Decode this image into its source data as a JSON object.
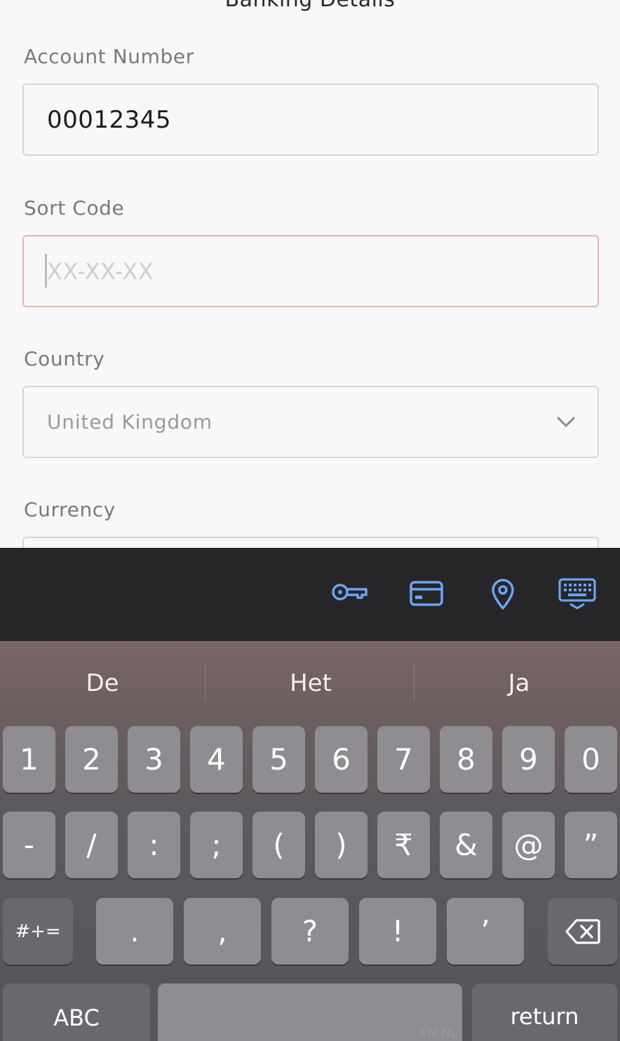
{
  "page": {
    "title": "Banking Details"
  },
  "fields": {
    "account_number": {
      "label": "Account Number",
      "value": "00012345"
    },
    "sort_code": {
      "label": "Sort Code",
      "placeholder": "XX-XX-XX",
      "value": ""
    },
    "country": {
      "label": "Country",
      "value": "United Kingdom"
    },
    "currency": {
      "label": "Currency"
    }
  },
  "accessory_bar": {
    "icons": [
      "key-icon",
      "credit-card-icon",
      "location-pin-icon",
      "keyboard-dismiss-icon"
    ],
    "accent": "#6aa5f2"
  },
  "keyboard": {
    "suggestions": [
      "De",
      "Het",
      "Ja"
    ],
    "row1": [
      "1",
      "2",
      "3",
      "4",
      "5",
      "6",
      "7",
      "8",
      "9",
      "0"
    ],
    "row2": [
      "-",
      "/",
      ":",
      ";",
      "(",
      ")",
      "₹",
      "&",
      "@",
      "”"
    ],
    "row3": {
      "toggle": "#+=",
      "keys": [
        ".",
        ",",
        "?",
        "!",
        "’"
      ],
      "backspace": "delete-icon"
    },
    "row4": {
      "abc": "ABC",
      "space_lang": "EN NL",
      "return": "return"
    }
  }
}
